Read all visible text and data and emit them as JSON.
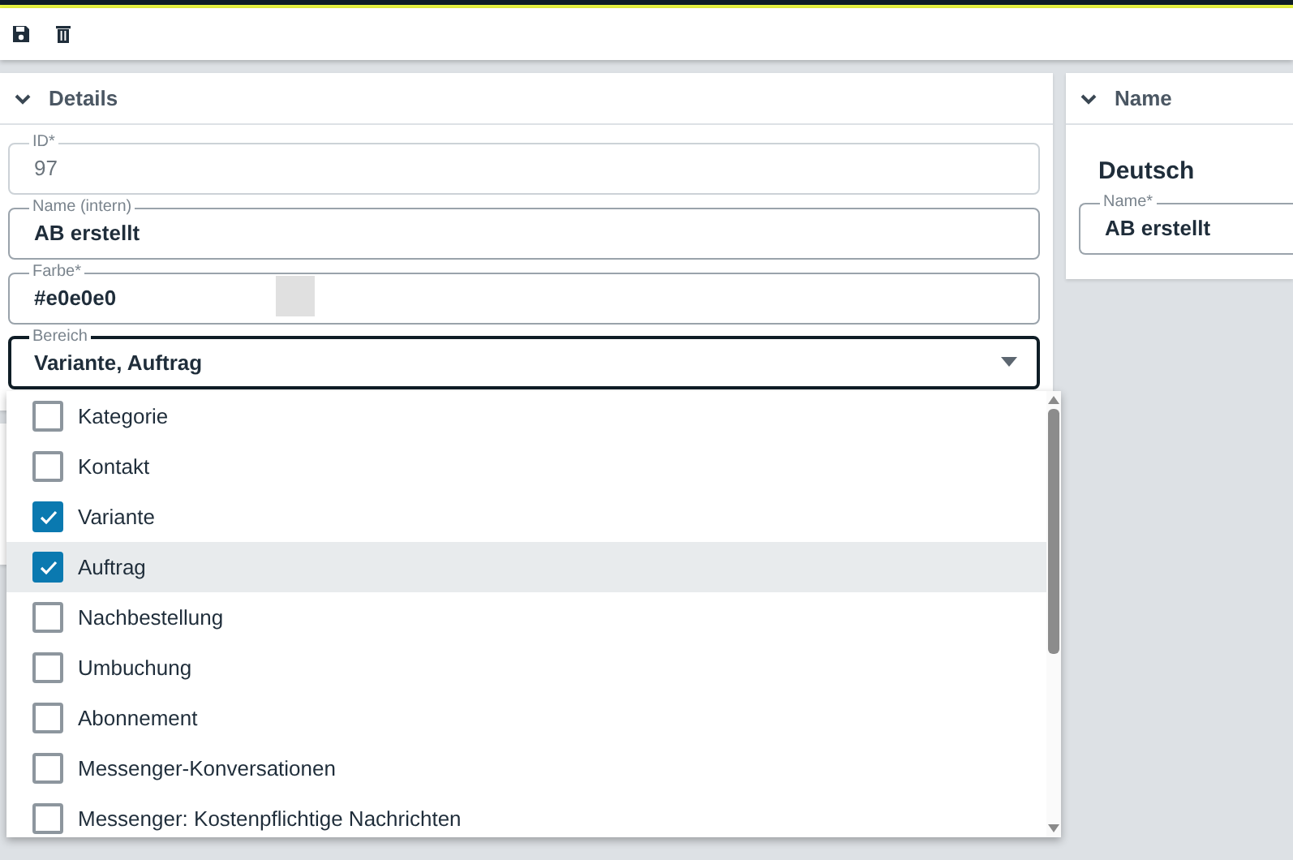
{
  "toolbar": {
    "buttons": [
      {
        "kind": "save"
      },
      {
        "kind": "delete"
      }
    ]
  },
  "details": {
    "title": "Details",
    "expanded": true,
    "fields": [
      {
        "kind": "text",
        "label": "ID*",
        "value": "97",
        "disabled": true,
        "focused": false
      },
      {
        "kind": "text",
        "label": "Name (intern)",
        "value": "AB erstellt",
        "disabled": false,
        "focused": false
      },
      {
        "kind": "color",
        "label": "Farbe*",
        "value": "#e0e0e0",
        "disabled": false,
        "focused": false
      },
      {
        "kind": "select",
        "label": "Bereich",
        "value": "Variante, Auftrag",
        "disabled": false,
        "focused": true
      }
    ]
  },
  "dropdown": {
    "options": [
      {
        "label": "Kategorie",
        "checked": false,
        "highlighted": false
      },
      {
        "label": "Kontakt",
        "checked": false,
        "highlighted": false
      },
      {
        "label": "Variante",
        "checked": true,
        "highlighted": false
      },
      {
        "label": "Auftrag",
        "checked": true,
        "highlighted": true
      },
      {
        "label": "Nachbestellung",
        "checked": false,
        "highlighted": false
      },
      {
        "label": "Umbuchung",
        "checked": false,
        "highlighted": false
      },
      {
        "label": "Abonnement",
        "checked": false,
        "highlighted": false
      },
      {
        "label": "Messenger-Konversationen",
        "checked": false,
        "highlighted": false
      },
      {
        "label": "Messenger: Kostenpflichtige Nachrichten",
        "checked": false,
        "highlighted": false
      }
    ]
  },
  "name_panel": {
    "title": "Name",
    "expanded": true,
    "language": "Deutsch",
    "fields": [
      {
        "label": "Name*",
        "value": "AB erstellt"
      }
    ]
  }
}
